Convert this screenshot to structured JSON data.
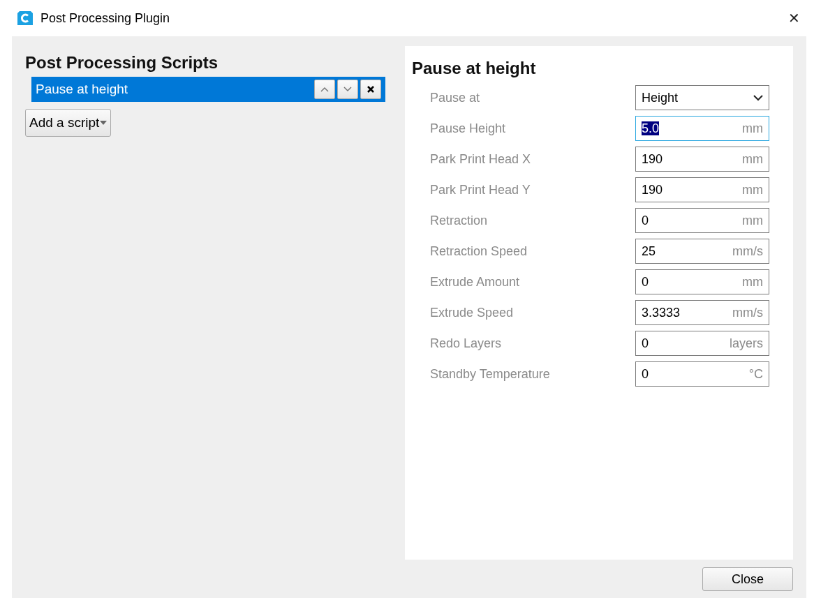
{
  "window": {
    "title": "Post Processing Plugin",
    "close_glyph": "✕"
  },
  "scripts_panel": {
    "title": "Post Processing Scripts",
    "scripts": [
      {
        "name": "Pause at height",
        "selected": true
      }
    ],
    "add_button": "Add a script"
  },
  "settings_panel": {
    "title": "Pause at height",
    "settings": [
      {
        "kind": "dropdown",
        "label": "Pause at",
        "value": "Height",
        "focused": false
      },
      {
        "kind": "number",
        "label": "Pause Height",
        "value": "5.0",
        "unit": "mm",
        "focused": true
      },
      {
        "kind": "number",
        "label": "Park Print Head X",
        "value": "190",
        "unit": "mm",
        "focused": false
      },
      {
        "kind": "number",
        "label": "Park Print Head Y",
        "value": "190",
        "unit": "mm",
        "focused": false
      },
      {
        "kind": "number",
        "label": "Retraction",
        "value": "0",
        "unit": "mm",
        "focused": false
      },
      {
        "kind": "number",
        "label": "Retraction Speed",
        "value": "25",
        "unit": "mm/s",
        "focused": false
      },
      {
        "kind": "number",
        "label": "Extrude Amount",
        "value": "0",
        "unit": "mm",
        "focused": false
      },
      {
        "kind": "number",
        "label": "Extrude Speed",
        "value": "3.3333",
        "unit": "mm/s",
        "focused": false
      },
      {
        "kind": "number",
        "label": "Redo Layers",
        "value": "0",
        "unit": "layers",
        "focused": false
      },
      {
        "kind": "number",
        "label": "Standby Temperature",
        "value": "0",
        "unit": "°C",
        "focused": false
      }
    ]
  },
  "close_button": "Close"
}
